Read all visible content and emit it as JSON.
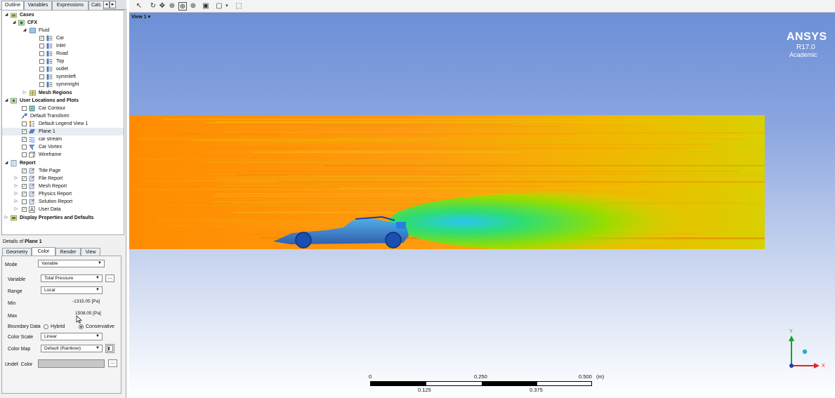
{
  "outline_tabs": [
    "Outline",
    "Variables",
    "Expressions",
    "Calc"
  ],
  "tree": {
    "cases": "Cases",
    "cfx": "CFX",
    "fluid": "Fluid",
    "boundaries": [
      "Car",
      "Inlet",
      "Road",
      "Top",
      "outlet",
      "symmleft",
      "symmright"
    ],
    "mesh_regions": "Mesh Regions",
    "user_locations": "User Locations and Plots",
    "car_contour": "Car Contour",
    "default_transform": "Default Transform",
    "default_legend": "Default Legend View 1",
    "plane1": "Plane 1",
    "car_stream": "car stream",
    "car_vortex": "Car Vortex",
    "wireframe": "Wireframe",
    "report": "Report",
    "report_items": [
      "Title Page",
      "File Report",
      "Mesh Report",
      "Physics Report",
      "Solution Report",
      "User Data"
    ],
    "display_props": "Display Properties and Defaults"
  },
  "details": {
    "prefix": "Details of ",
    "object": "Plane 1",
    "tabs": [
      "Geometry",
      "Color",
      "Render",
      "View"
    ],
    "mode_label": "Mode",
    "mode_value": "Variable",
    "variable_label": "Variable",
    "variable_value": "Total Pressure",
    "range_label": "Range",
    "range_value": "Local",
    "min_label": "Min",
    "min_value": "-1315.05 [Pa]",
    "max_label": "Max",
    "max_value": "1508.05 [Pa]",
    "boundary_label": "Boundary Data",
    "boundary_hybrid": "Hybrid",
    "boundary_conservative": "Conservative",
    "color_scale_label": "Color Scale",
    "color_scale_value": "Linear",
    "color_map_label": "Color Map",
    "color_map_value": "Default (Rainbow)",
    "undef_label": "Undef. Color",
    "ellipsis": "..."
  },
  "viewer": {
    "view_label": "View 1",
    "brand": "ANSYS",
    "version": "R17.0",
    "edition": "Academic",
    "scale": {
      "ticks_top": [
        "0",
        "0.250",
        "0.500"
      ],
      "unit": "(m)",
      "ticks_bottom": [
        "0.125",
        "0.375"
      ]
    },
    "axes": {
      "x": "X",
      "y": "Y"
    }
  },
  "colors": {
    "sky_top": "#6c8fd6",
    "stream_orange": "#ff8a00",
    "stream_yellow": "#d7dc00",
    "wake_green": "#34d63a",
    "car_blue": "#2a8fd8"
  }
}
